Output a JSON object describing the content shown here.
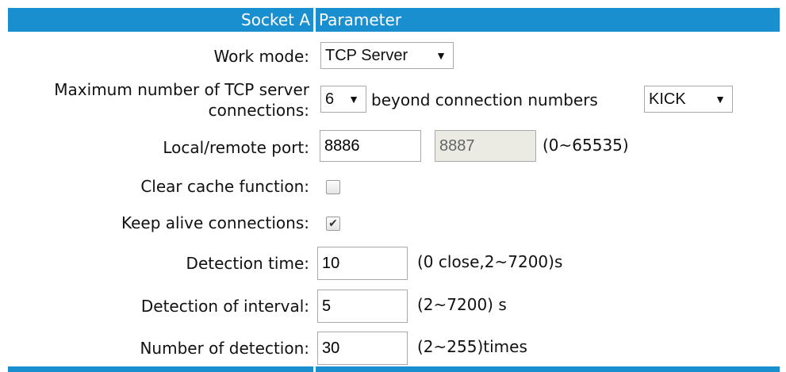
{
  "header": {
    "left": "Socket A",
    "right": "Parameter"
  },
  "work_mode": {
    "label": "Work mode:",
    "value": "TCP Server"
  },
  "max_conn": {
    "label_line1": "Maximum number of TCP server",
    "label_line2": "connections:",
    "value": "6",
    "beyond_label": "beyond connection numbers",
    "beyond_value": "KICK"
  },
  "port": {
    "label": "Local/remote port:",
    "local": "8886",
    "remote": "8887",
    "hint": "(0~65535)"
  },
  "clear_cache": {
    "label": "Clear cache function:",
    "checked": false
  },
  "keep_alive": {
    "label": "Keep alive connections:",
    "checked": true,
    "check_glyph": "✔"
  },
  "detection_time": {
    "label": "Detection time:",
    "value": "10",
    "hint": "(0 close,2~7200)s"
  },
  "detection_interval": {
    "label": "Detection of interval:",
    "value": "5",
    "hint": "(2~7200) s"
  },
  "detection_count": {
    "label": "Number of detection:",
    "value": "30",
    "hint": "(2~255)times"
  },
  "arrow_glyph": "▼"
}
